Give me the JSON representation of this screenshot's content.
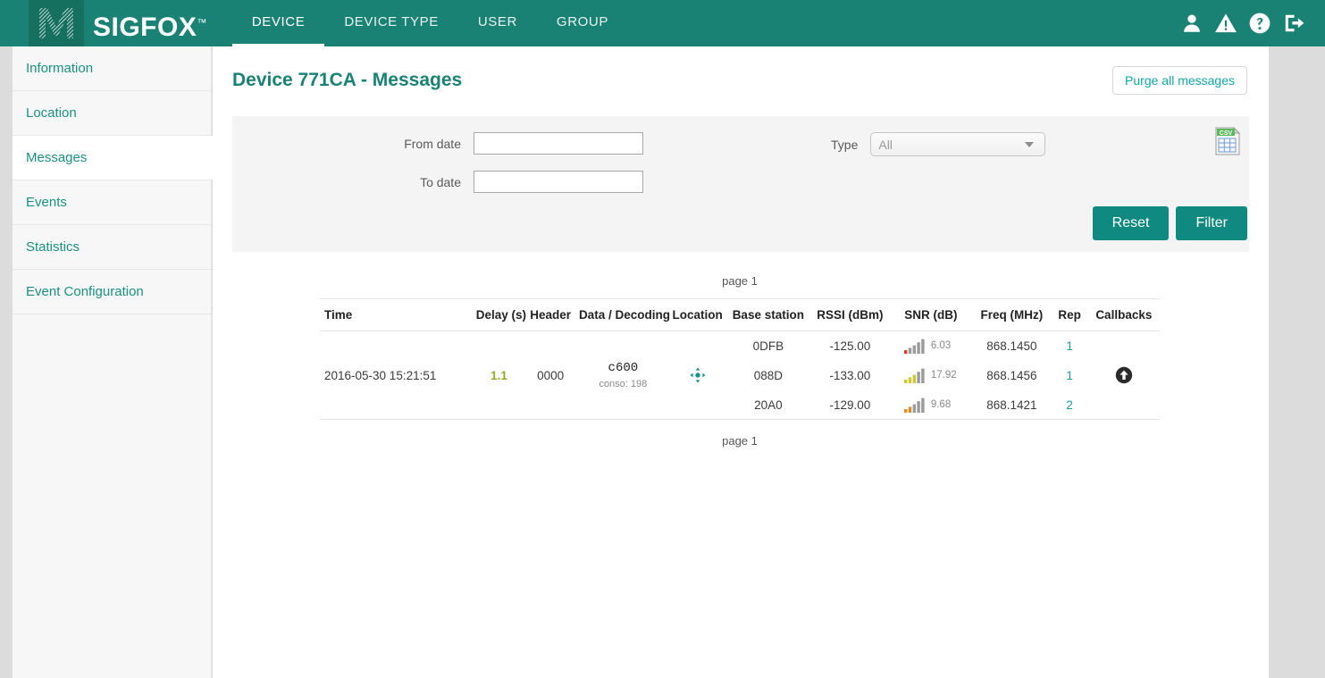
{
  "navbar": {
    "brand": "SIGFOX",
    "brand_tm": "™",
    "links": [
      {
        "label": "DEVICE",
        "active": true
      },
      {
        "label": "DEVICE TYPE",
        "active": false
      },
      {
        "label": "USER",
        "active": false
      },
      {
        "label": "GROUP",
        "active": false
      }
    ],
    "icons": [
      {
        "name": "user-icon"
      },
      {
        "name": "warning-icon"
      },
      {
        "name": "help-icon"
      },
      {
        "name": "logout-icon"
      }
    ],
    "background": "#1a8274"
  },
  "sidebar": {
    "items": [
      {
        "label": "Information",
        "active": false
      },
      {
        "label": "Location",
        "active": false
      },
      {
        "label": "Messages",
        "active": true
      },
      {
        "label": "Events",
        "active": false
      },
      {
        "label": "Statistics",
        "active": false
      },
      {
        "label": "Event Configuration",
        "active": false
      }
    ]
  },
  "main": {
    "title": "Device 771CA - Messages",
    "purge_label": "Purge all messages"
  },
  "filter": {
    "from_label": "From date",
    "from_value": "",
    "from_placeholder": "",
    "to_label": "To date",
    "to_value": "",
    "to_placeholder": "",
    "type_label": "Type",
    "type_value": "All",
    "type_options": [
      "All"
    ],
    "csv_label": "CSV",
    "reset_label": "Reset",
    "filter_label": "Filter"
  },
  "table": {
    "pager_top": "page 1",
    "pager_bottom": "page 1",
    "columns": [
      "Time",
      "Delay (s)",
      "Header",
      "Data / Decoding",
      "Location",
      "Base station",
      "RSSI (dBm)",
      "SNR (dB)",
      "Freq (MHz)",
      "Rep",
      "Callbacks"
    ],
    "rows": [
      {
        "time": "2016-05-30 15:21:51",
        "delay": "1.1",
        "header": "0000",
        "data": "c600",
        "data_sub": "conso: 198",
        "location_icon": "crosshair-icon",
        "callbacks_icon": "arrow-up-circle-icon",
        "stations": [
          {
            "base_station": "0DFB",
            "rssi": "-125.00",
            "snr": "6.03",
            "snr_bars": 1,
            "snr_color": "#e03a2f",
            "freq": "868.1450",
            "rep": "1"
          },
          {
            "base_station": "088D",
            "rssi": "-133.00",
            "snr": "17.92",
            "snr_bars": 3,
            "snr_color": "#cfc830",
            "freq": "868.1456",
            "rep": "1"
          },
          {
            "base_station": "20A0",
            "rssi": "-129.00",
            "snr": "9.68",
            "snr_bars": 2,
            "snr_color": "#e98b22",
            "freq": "868.1421",
            "rep": "2"
          }
        ]
      }
    ]
  },
  "colors": {
    "brand_teal": "#1a8274",
    "link_teal": "#1a8f82",
    "button_teal": "#108a80",
    "delay_olive": "#9aa829",
    "rep_link": "#1a9a9a"
  }
}
